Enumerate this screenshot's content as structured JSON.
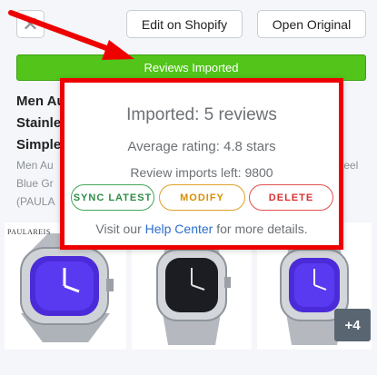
{
  "header": {
    "close_symbol": "✕",
    "edit_label": "Edit on Shopify",
    "open_label": "Open Original"
  },
  "status": {
    "label": "Reviews Imported",
    "color": "#52c41a"
  },
  "product": {
    "title_lines": [
      "Men Au",
      "Stainles",
      "Simple"
    ],
    "desc_lines": [
      "Men Au",
      "Blue Gr",
      "(PAULA"
    ],
    "desc_tail": "teel"
  },
  "gallery": {
    "brand": "PAULAREIS",
    "more_count": "+4"
  },
  "popup": {
    "headline": "Imported: 5 reviews",
    "rating": "Average rating: 4.8 stars",
    "imports_left": "Review imports left: 9800",
    "sync_label": "SYNC LATEST",
    "modify_label": "MODIFY",
    "delete_label": "DELETE",
    "help_prefix": "Visit our",
    "help_link": "Help Center",
    "help_suffix": "for more details.",
    "border_color": "#ee0000"
  },
  "annotation": {
    "arrow_color": "#ee0000"
  }
}
